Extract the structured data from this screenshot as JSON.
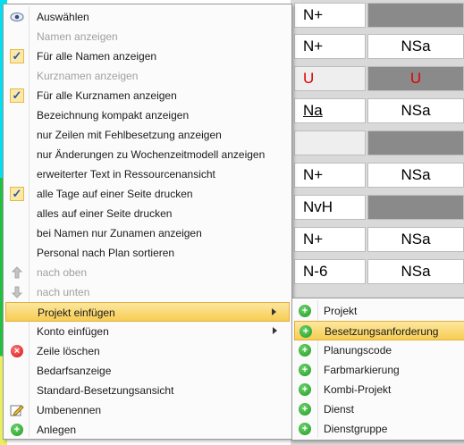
{
  "background_grid": {
    "rows": [
      {
        "c1": "N+",
        "c2": "",
        "c2_style": "dark"
      },
      {
        "c1": "N+",
        "c2": "NSa"
      },
      {
        "c1": "U",
        "c2": "U",
        "c1_style": "red-light",
        "c2_style": "red-dark"
      },
      {
        "c1": "Na",
        "c2": "NSa",
        "c1_style": "underline"
      },
      {
        "c1": "",
        "c2": "",
        "c1_style": "light",
        "c2_style": "dark"
      },
      {
        "c1": "N+",
        "c2": "NSa"
      },
      {
        "c1": "NvH",
        "c2": "",
        "c2_style": "dark"
      },
      {
        "c1": "N+",
        "c2": "NSa"
      },
      {
        "c1": "N-6",
        "c2": "NSa"
      }
    ]
  },
  "context_menu": {
    "items": [
      {
        "label": "Auswählen",
        "icon": "eye-icon"
      },
      {
        "label": "Namen anzeigen",
        "disabled": true
      },
      {
        "label": "Für alle Namen anzeigen",
        "icon": "checkmark-icon",
        "checked": true
      },
      {
        "label": "Kurznamen anzeigen",
        "disabled": true
      },
      {
        "label": "Für alle Kurznamen anzeigen",
        "icon": "checkmark-icon",
        "checked": true
      },
      {
        "label": "Bezeichnung kompakt anzeigen"
      },
      {
        "label": "nur Zeilen mit Fehlbesetzung anzeigen"
      },
      {
        "label": "nur Änderungen zu Wochenzeitmodell anzeigen"
      },
      {
        "label": "erweiterter Text in Ressourcenansicht"
      },
      {
        "label": "alle Tage auf einer Seite drucken",
        "icon": "checkmark-icon",
        "checked": true
      },
      {
        "label": "alles auf einer Seite drucken"
      },
      {
        "label": "bei Namen nur Zunamen anzeigen"
      },
      {
        "label": "Personal nach Plan sortieren"
      },
      {
        "label": "nach oben",
        "icon": "arrow-up-icon",
        "disabled": true
      },
      {
        "label": "nach unten",
        "icon": "arrow-down-icon",
        "disabled": true
      },
      {
        "label": "Projekt einfügen",
        "has_submenu": true,
        "highlighted": true
      },
      {
        "label": "Konto einfügen",
        "has_submenu": true
      },
      {
        "label": "Zeile löschen",
        "icon": "delete-icon"
      },
      {
        "label": "Bedarfsanzeige"
      },
      {
        "label": "Standard-Besetzungsansicht"
      },
      {
        "label": "Umbenennen",
        "icon": "rename-icon"
      },
      {
        "label": "Anlegen",
        "icon": "add-icon"
      }
    ]
  },
  "submenu": {
    "items": [
      {
        "label": "Projekt",
        "icon": "add-icon"
      },
      {
        "label": "Besetzungsanforderung",
        "icon": "add-icon",
        "highlighted": true
      },
      {
        "label": "Planungscode",
        "icon": "add-icon"
      },
      {
        "label": "Farbmarkierung",
        "icon": "add-icon"
      },
      {
        "label": "Kombi-Projekt",
        "icon": "add-icon"
      },
      {
        "label": "Dienst",
        "icon": "add-icon"
      },
      {
        "label": "Dienstgruppe",
        "icon": "add-icon"
      }
    ]
  },
  "colors": {
    "highlight": "#f7cd52",
    "add_icon": "#1f9a1f",
    "delete_icon": "#d01010",
    "red_text": "#e00000"
  }
}
